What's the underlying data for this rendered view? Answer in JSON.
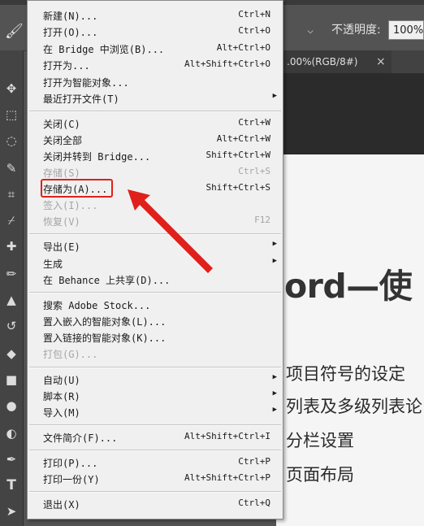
{
  "options_bar": {
    "opacity_label": "不透明度:",
    "opacity_value": "100%"
  },
  "document_tab": {
    "title": ".00%(RGB/8#)",
    "close": "×"
  },
  "document": {
    "heading": "ord—使",
    "lines": [
      "项目符号的设定",
      "列表及多级列表论",
      "分栏设置",
      "页面布局"
    ]
  },
  "file_menu": {
    "items": [
      {
        "label": "新建(N)...",
        "shortcut": "Ctrl+N"
      },
      {
        "label": "打开(O)...",
        "shortcut": "Ctrl+O"
      },
      {
        "label": "在 Bridge 中浏览(B)...",
        "shortcut": "Alt+Ctrl+O"
      },
      {
        "label": "打开为...",
        "shortcut": "Alt+Shift+Ctrl+O"
      },
      {
        "label": "打开为智能对象...",
        "shortcut": ""
      },
      {
        "label": "最近打开文件(T)",
        "shortcut": "",
        "submenu": true
      },
      {
        "label": "关闭(C)",
        "shortcut": "Ctrl+W"
      },
      {
        "label": "关闭全部",
        "shortcut": "Alt+Ctrl+W"
      },
      {
        "label": "关闭并转到 Bridge...",
        "shortcut": "Shift+Ctrl+W"
      },
      {
        "label": "存储(S)",
        "shortcut": "Ctrl+S",
        "disabled": true
      },
      {
        "label": "存储为(A)...",
        "shortcut": "Shift+Ctrl+S"
      },
      {
        "label": "签入(I)...",
        "shortcut": "",
        "disabled": true
      },
      {
        "label": "恢复(V)",
        "shortcut": "F12",
        "disabled": true
      },
      {
        "label": "导出(E)",
        "shortcut": "",
        "submenu": true
      },
      {
        "label": "生成",
        "shortcut": "",
        "submenu": true
      },
      {
        "label": "在 Behance 上共享(D)...",
        "shortcut": ""
      },
      {
        "label": "搜索 Adobe Stock...",
        "shortcut": ""
      },
      {
        "label": "置入嵌入的智能对象(L)...",
        "shortcut": ""
      },
      {
        "label": "置入链接的智能对象(K)...",
        "shortcut": ""
      },
      {
        "label": "打包(G)...",
        "shortcut": "",
        "disabled": true
      },
      {
        "label": "自动(U)",
        "shortcut": "",
        "submenu": true
      },
      {
        "label": "脚本(R)",
        "shortcut": "",
        "submenu": true
      },
      {
        "label": "导入(M)",
        "shortcut": "",
        "submenu": true
      },
      {
        "label": "文件简介(F)...",
        "shortcut": "Alt+Shift+Ctrl+I"
      },
      {
        "label": "打印(P)...",
        "shortcut": "Ctrl+P"
      },
      {
        "label": "打印一份(Y)",
        "shortcut": "Alt+Shift+Ctrl+P"
      },
      {
        "label": "退出(X)",
        "shortcut": "Ctrl+Q"
      }
    ]
  },
  "colors": {
    "highlight_box": "#e0201a",
    "arrow": "#e0201a"
  },
  "icons": {
    "submenu": "submenu-arrow-icon",
    "tools": [
      "move-tool-icon",
      "marquee-tool-icon",
      "lasso-tool-icon",
      "quick-select-icon",
      "crop-tool-icon",
      "eyedropper-icon",
      "healing-brush-icon",
      "brush-tool-icon",
      "stamp-tool-icon",
      "history-brush-icon",
      "eraser-icon",
      "gradient-icon",
      "blur-icon",
      "dodge-icon",
      "pen-tool-icon",
      "type-tool-icon",
      "path-select-icon"
    ]
  }
}
